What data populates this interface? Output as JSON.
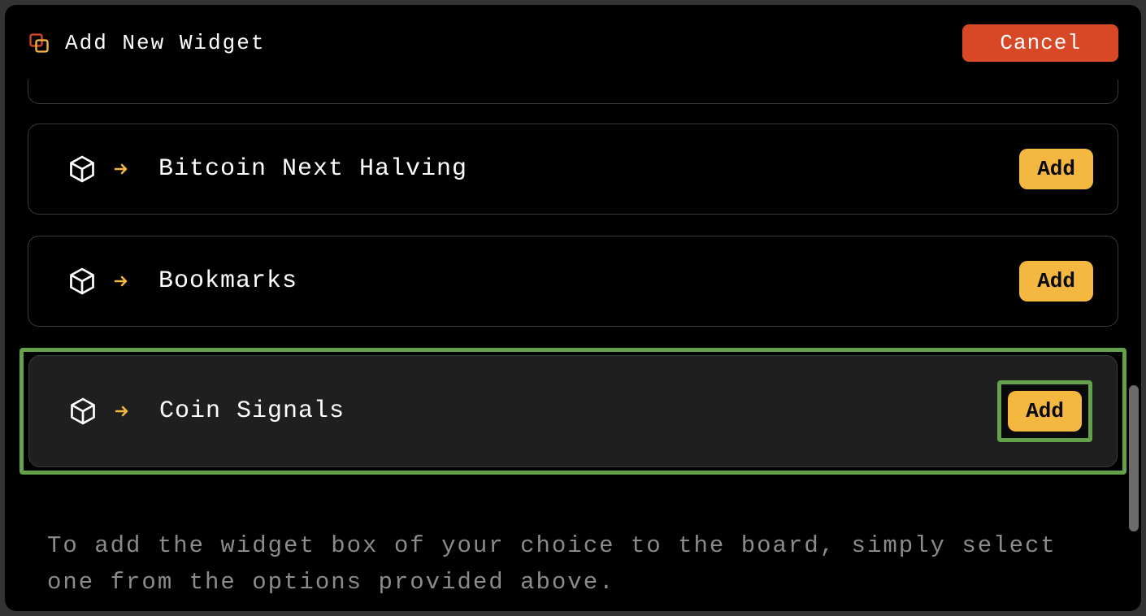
{
  "header": {
    "title": "Add New Widget",
    "cancel_label": "Cancel"
  },
  "widgets": [
    {
      "label": "Bitcoin Next Halving",
      "add_label": "Add"
    },
    {
      "label": "Bookmarks",
      "add_label": "Add"
    },
    {
      "label": "Coin Signals",
      "add_label": "Add"
    }
  ],
  "help_text": "To add the widget box of your choice to the board, simply select one from the options provided above."
}
